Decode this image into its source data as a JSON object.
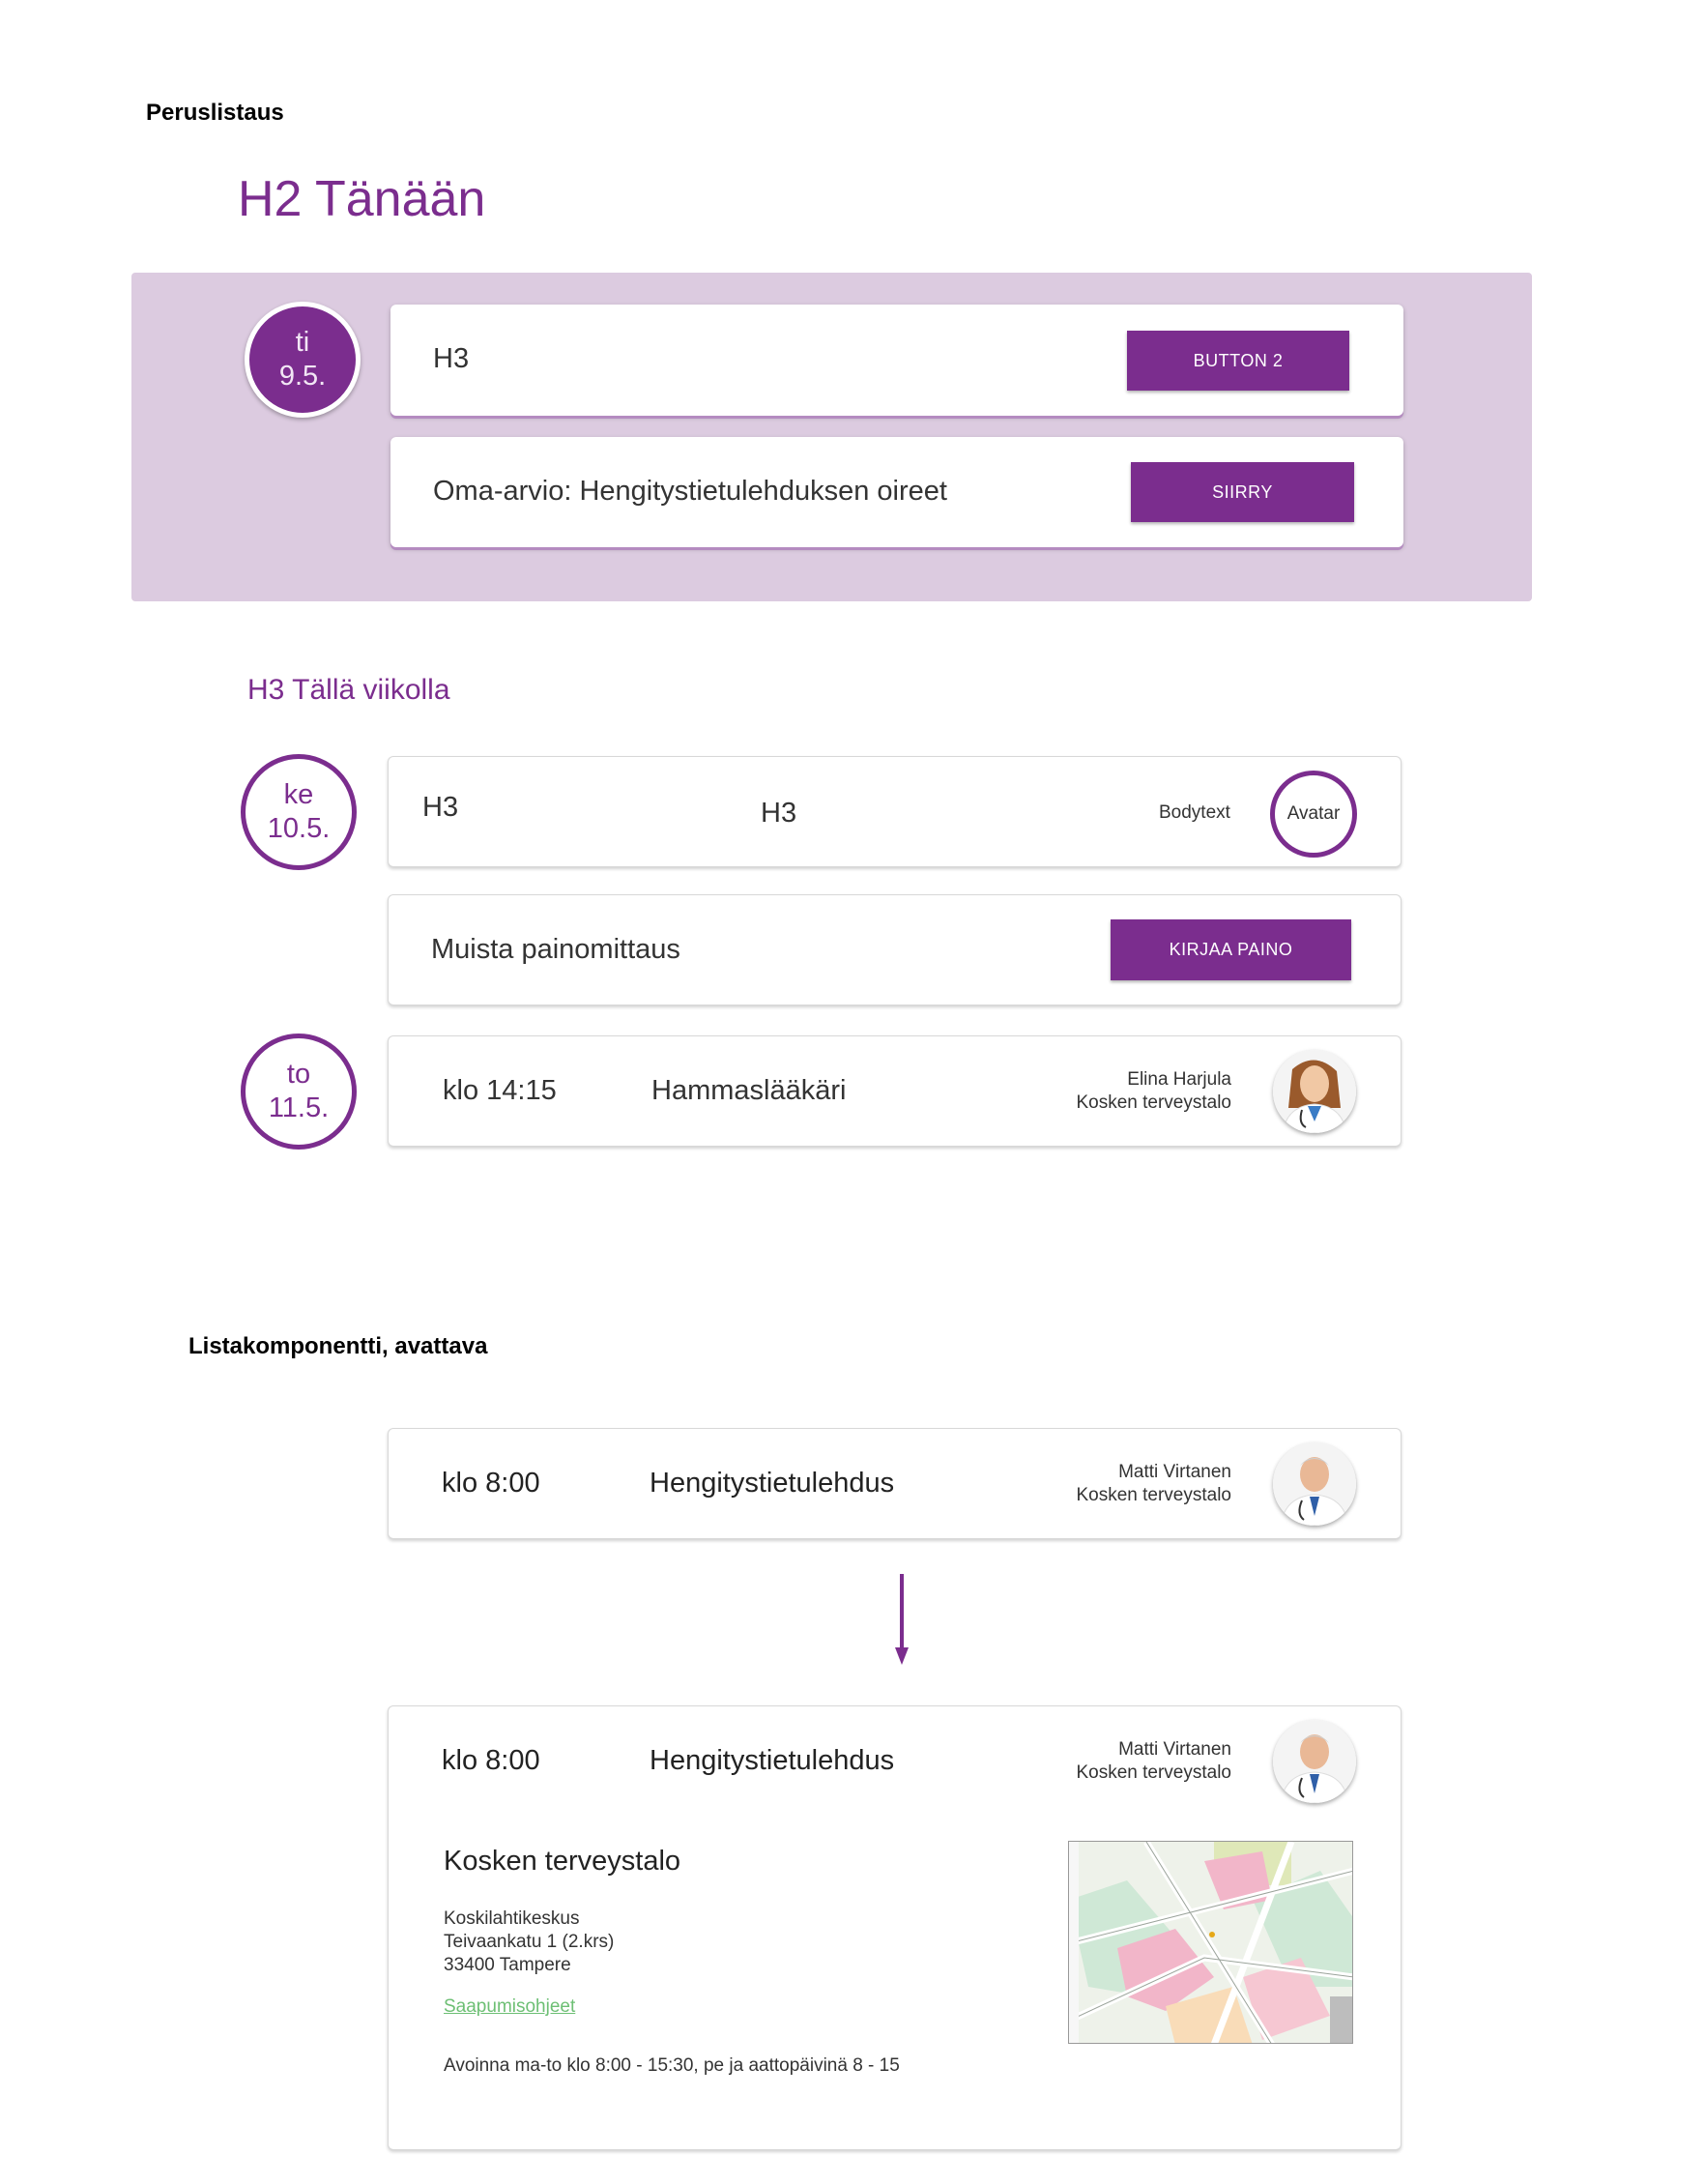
{
  "sections": {
    "basic_list_label": "Peruslistaus",
    "expandable_label": "Listakomponentti, avattava"
  },
  "today": {
    "heading": "H2 Tänään",
    "date_day": "ti",
    "date_num": "9.5.",
    "card1": {
      "title": "H3",
      "button": "BUTTON 2"
    },
    "card2": {
      "title": "Oma-arvio: Hengitystietulehduksen oireet",
      "button": "SIIRRY"
    }
  },
  "week": {
    "heading": "H3 Tällä viikolla",
    "day1": {
      "day": "ke",
      "num": "10.5."
    },
    "row1": {
      "left": "H3",
      "center": "H3",
      "body": "Bodytext",
      "avatar": "Avatar"
    },
    "row2": {
      "title": "Muista painomittaus",
      "button": "KIRJAA PAINO"
    },
    "day2": {
      "day": "to",
      "num": "11.5."
    },
    "row3": {
      "time": "klo 14:15",
      "title": "Hammaslääkäri",
      "person": "Elina Harjula",
      "place": "Kosken terveystalo"
    }
  },
  "expandable": {
    "collapsed": {
      "time": "klo 8:00",
      "title": "Hengitystietulehdus",
      "person": "Matti Virtanen",
      "place": "Kosken terveystalo"
    },
    "expanded": {
      "time": "klo 8:00",
      "title": "Hengitystietulehdus",
      "person": "Matti Virtanen",
      "place": "Kosken terveystalo",
      "location_title": "Kosken terveystalo",
      "address_line1": "Koskilahtikeskus",
      "address_line2": "Teivaankatu 1 (2.krs)",
      "address_line3": "33400 Tampere",
      "link": "Saapumisohjeet",
      "hours": "Avoinna ma-to klo 8:00 - 15:30, pe ja aattopäivinä 8 - 15"
    }
  },
  "colors": {
    "accent": "#7b2d8e",
    "panel": "#dccbe0",
    "link": "#6dbf74"
  }
}
